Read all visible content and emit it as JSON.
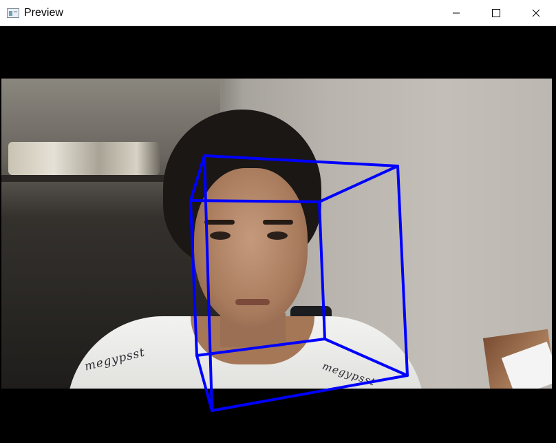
{
  "window": {
    "title": "Preview",
    "icon": "app-window-icon"
  },
  "controls": {
    "minimize_icon": "minimize-icon",
    "maximize_icon": "maximize-icon",
    "close_icon": "close-icon"
  },
  "overlay": {
    "shape": "3d-cube-wireframe",
    "color": "#0000ff"
  },
  "preview": {
    "shirt_text_left": "megypsst",
    "shirt_text_right": "megypsst"
  }
}
